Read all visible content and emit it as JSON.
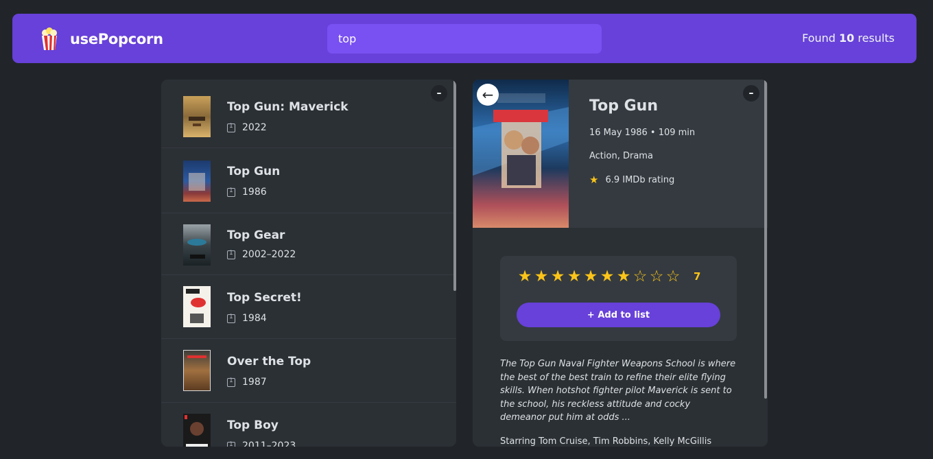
{
  "nav": {
    "logo_text": "usePopcorn",
    "search_value": "top",
    "results_prefix": "Found",
    "results_count": "10",
    "results_suffix": "results"
  },
  "list": {
    "toggle_label": "–",
    "movies": [
      {
        "title": "Top Gun: Maverick",
        "year": "2022"
      },
      {
        "title": "Top Gun",
        "year": "1986"
      },
      {
        "title": "Top Gear",
        "year": "2002–2022"
      },
      {
        "title": "Top Secret!",
        "year": "1984"
      },
      {
        "title": "Over the Top",
        "year": "1987"
      },
      {
        "title": "Top Boy",
        "year": "2011–2023"
      }
    ]
  },
  "details": {
    "toggle_label": "–",
    "back_label": "←",
    "title": "Top Gun",
    "released_runtime": "16 May 1986 • 109 min",
    "genre": "Action, Drama",
    "imdb_rating": "6.9 IMDb rating",
    "user_rating": "7",
    "user_rating_max": 10,
    "add_label": "+ Add to list",
    "plot": "The Top Gun Naval Fighter Weapons School is where the best of the best train to refine their elite flying skills. When hotshot fighter pilot Maverick is sent to the school, his reckless attitude and cocky demeanor put him at odds ...",
    "starring": "Starring Tom Cruise, Tim Robbins, Kelly McGillis"
  },
  "colors": {
    "brand": "#6741d9",
    "search_bg": "#7950f2",
    "star": "#fcc419",
    "background": "#212529",
    "panel": "#2b3035"
  }
}
